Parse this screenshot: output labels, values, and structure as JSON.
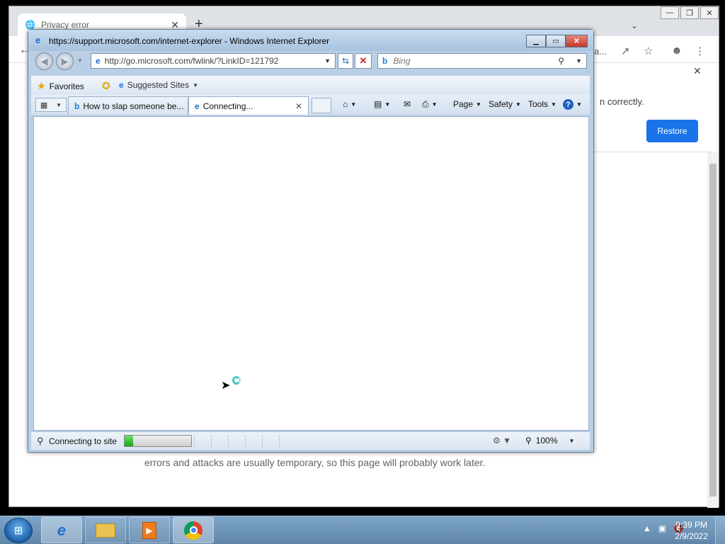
{
  "chrome": {
    "tab_title": "Privacy error",
    "omnibox_tail": "a...",
    "restore_message": "n correctly.",
    "restore_button": "Restore",
    "body_text": "errors and attacks are usually temporary, so this page will probably work later."
  },
  "ie": {
    "window_title": "https://support.microsoft.com/internet-explorer - Windows Internet Explorer",
    "address": "http://go.microsoft.com/fwlink/?LinkID=121792",
    "search_placeholder": "Bing",
    "favorites_label": "Favorites",
    "suggested_sites_label": "Suggested Sites",
    "tabs": [
      {
        "label": "How to slap someone be...",
        "icon": "bing-icon",
        "active": false
      },
      {
        "label": "Connecting...",
        "icon": "ie-icon",
        "active": true
      }
    ],
    "commands": {
      "page": "Page",
      "safety": "Safety",
      "tools": "Tools"
    },
    "status_text": "Connecting to site",
    "progress_fraction": 0.13,
    "zoom": "100%"
  },
  "taskbar": {
    "apps": [
      "internet-explorer",
      "windows-explorer",
      "media-player",
      "google-chrome"
    ],
    "time": "9:39 PM",
    "date": "2/9/2022"
  },
  "colors": {
    "chrome_accent": "#1a73e8",
    "ie_frame": "#b9cfe5",
    "progress_fill": "#17a317",
    "taskbar": "#6d93b8"
  }
}
